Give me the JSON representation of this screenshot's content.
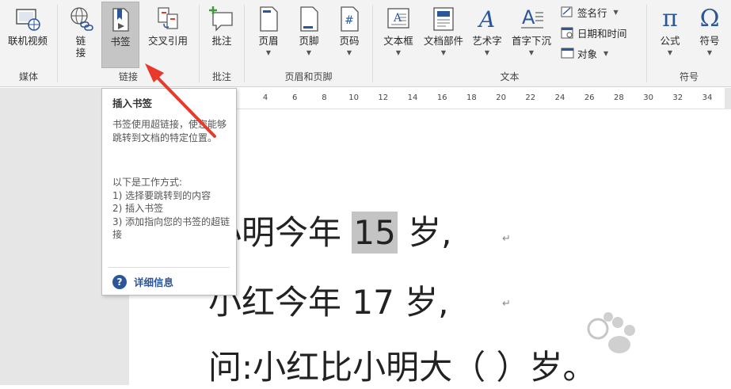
{
  "ribbon": {
    "groups": [
      {
        "label": "媒体",
        "buttons": [
          {
            "label": "联机视频"
          }
        ]
      },
      {
        "label": "链接",
        "buttons": [
          {
            "label": "链接"
          },
          {
            "label": "书签"
          },
          {
            "label": "交叉引用"
          }
        ]
      },
      {
        "label": "批注",
        "buttons": [
          {
            "label": "批注"
          }
        ]
      },
      {
        "label": "页眉和页脚",
        "buttons": [
          {
            "label": "页眉"
          },
          {
            "label": "页脚"
          },
          {
            "label": "页码"
          }
        ]
      },
      {
        "label": "文本",
        "buttons": [
          {
            "label": "文本框"
          },
          {
            "label": "文档部件"
          },
          {
            "label": "艺术字"
          },
          {
            "label": "首字下沉"
          }
        ],
        "small": [
          {
            "label": "签名行"
          },
          {
            "label": "日期和时间"
          },
          {
            "label": "对象"
          }
        ]
      },
      {
        "label": "符号",
        "buttons": [
          {
            "label": "公式"
          },
          {
            "label": "符号"
          }
        ]
      }
    ],
    "link_btn_label": "链\n接",
    "number_glyph": "#",
    "pi_glyph": "π",
    "omega_glyph": "Ω",
    "wordart_glyph": "A"
  },
  "ruler": {
    "numbers": [
      "4",
      "6",
      "8",
      "10",
      "12",
      "14",
      "16",
      "18",
      "20",
      "22",
      "24",
      "26",
      "28",
      "30",
      "32",
      "34"
    ]
  },
  "document": {
    "line1": {
      "before": "小明今年 ",
      "highlight": "15",
      "after": " 岁,"
    },
    "line2": "小红今年 17 岁,",
    "line3": "问:小红比小明大（  ）岁。",
    "paragraph_mark": "↵"
  },
  "tooltip": {
    "title": "插入书签",
    "body": "书签使用超链接，使您能够跳转到文档的特定位置。",
    "how_title": "以下是工作方式:",
    "steps": [
      "1) 选择要跳转到的内容",
      "2) 插入书签",
      "3) 添加指向您的书签的超链接"
    ],
    "more_icon": "?",
    "more": "详细信息"
  },
  "colors": {
    "accent": "#2b579a",
    "arrow": "#e8392b",
    "highlight": "#c4c4c4",
    "ribbon_bg": "#f3f3f3"
  }
}
